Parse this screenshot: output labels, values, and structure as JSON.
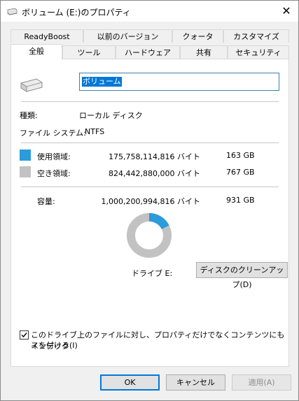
{
  "window": {
    "title": "ボリューム (E:)のプロパティ",
    "close_glyph": "✕"
  },
  "tabs_back": [
    "ReadyBoost",
    "以前のバージョン",
    "クォータ",
    "カスタマイズ"
  ],
  "tabs_front": [
    "全般",
    "ツール",
    "ハードウェア",
    "共有",
    "セキュリティ"
  ],
  "general": {
    "volume_name": "ボリューム",
    "type_label": "種類:",
    "type_value": "ローカル ディスク",
    "fs_label": "ファイル システム:",
    "fs_value": "NTFS",
    "used_label": "使用領域:",
    "used_bytes": "175,758,114,816 バイト",
    "used_size": "163 GB",
    "free_label": "空き領域:",
    "free_bytes": "824,442,880,000 バイト",
    "free_size": "767 GB",
    "cap_label": "容量:",
    "cap_bytes": "1,000,200,994,816 バイト",
    "cap_size": "931 GB",
    "drive_label": "ドライブ E:",
    "cleanup_button": "ディスクのクリーンアップ(D)",
    "index_line1": "このドライブ上のファイルに対し、プロパティだけでなくコンテンツにもインデック",
    "index_line2": "スを付ける(I)",
    "used_fraction": 0.1757
  },
  "colors": {
    "used": "#2b9bdc",
    "free": "#c2c2c2",
    "accent": "#0078d7"
  },
  "buttons": {
    "ok": "OK",
    "cancel": "キャンセル",
    "apply": "適用(A)"
  }
}
